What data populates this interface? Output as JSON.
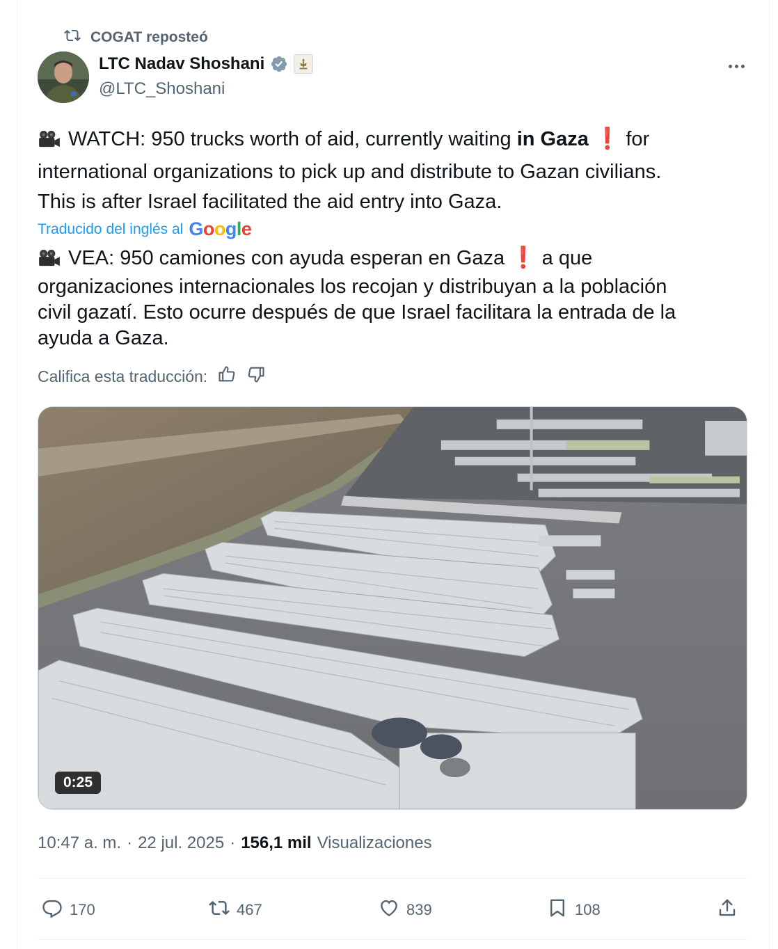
{
  "repost": {
    "label": "COGAT reposteó",
    "icon": "repost-icon"
  },
  "author": {
    "name": "LTC Nadav Shoshani",
    "handle": "@LTC_Shoshani",
    "verified_color": "#829aab"
  },
  "tweet": {
    "line1_pre": " WATCH: 950 trucks worth of aid, currently waiting ",
    "line1_bold": "in Gaza",
    "excl": "❗",
    "line1_post": " for",
    "line2": "international organizations to pick up and distribute to Gazan civilians.",
    "line3": "This is after Israel facilitated the aid entry into Gaza."
  },
  "translation_note": {
    "label": "Traducido del inglés al",
    "brand": "Google"
  },
  "translation": {
    "line1_pre": " VEA: 950 camiones con ayuda esperan en Gaza ",
    "line1_post": " a que",
    "line2": "organizaciones internacionales los recojan y distribuyan a la población",
    "line3": "civil gazatí. Esto ocurre después de que Israel facilitara la entrada de la",
    "line4": "ayuda a Gaza."
  },
  "rate": {
    "label": "Califica esta traducción:"
  },
  "video": {
    "duration": "0:25"
  },
  "meta": {
    "time": "10:47 a. m.",
    "sep": "·",
    "date": "22 jul. 2025",
    "views_count": "156,1 mil",
    "views_label": "Visualizaciones"
  },
  "actions": {
    "replies": "170",
    "reposts": "467",
    "likes": "839",
    "bookmarks": "108"
  },
  "colors": {
    "link": "#1d9bf0",
    "muted": "#536471",
    "text": "#0f1419",
    "accent_red": "#d81e1e"
  }
}
